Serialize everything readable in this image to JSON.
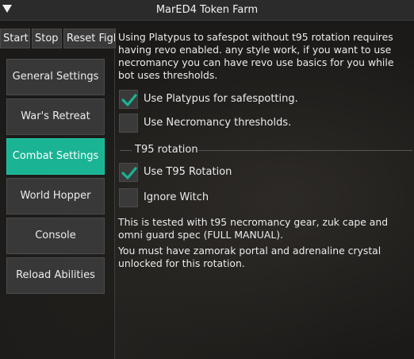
{
  "window": {
    "title": "MarED4 Token Farm"
  },
  "toolbar": {
    "start_label": "Start",
    "stop_label": "Stop",
    "reset_label": "Reset Figh"
  },
  "sidebar": {
    "items": [
      {
        "label": "General Settings",
        "active": false
      },
      {
        "label": "War's Retreat",
        "active": false
      },
      {
        "label": "Combat Settings",
        "active": true
      },
      {
        "label": "World Hopper",
        "active": false
      },
      {
        "label": "Console",
        "active": false
      },
      {
        "label": "Reload Abilities",
        "active": false
      }
    ]
  },
  "main": {
    "intro_text": "Using Platypus to safespot without t95 rotation requires having revo enabled. any style work, if you want to use necromancy you can have revo use basics for you while bot uses thresholds.",
    "platypus": {
      "label": "Use Platypus for safespotting.",
      "checked": true
    },
    "necro_thresholds": {
      "label": "Use Necromancy thresholds.",
      "checked": false
    },
    "t95_section_title": "T95 rotation",
    "t95": {
      "label": "Use T95 Rotation",
      "checked": true
    },
    "ignore_witch": {
      "label": "Ignore Witch",
      "checked": false
    },
    "note_1": "This is tested with t95 necromancy gear, zuk cape and omni guard spec (FULL MANUAL).",
    "note_2": "You must have zamorak portal and adrenaline crystal unlocked for this rotation."
  },
  "colors": {
    "accent": "#1ab394",
    "button_bg": "#383838",
    "titlebar_bg": "#2b2b2b"
  }
}
